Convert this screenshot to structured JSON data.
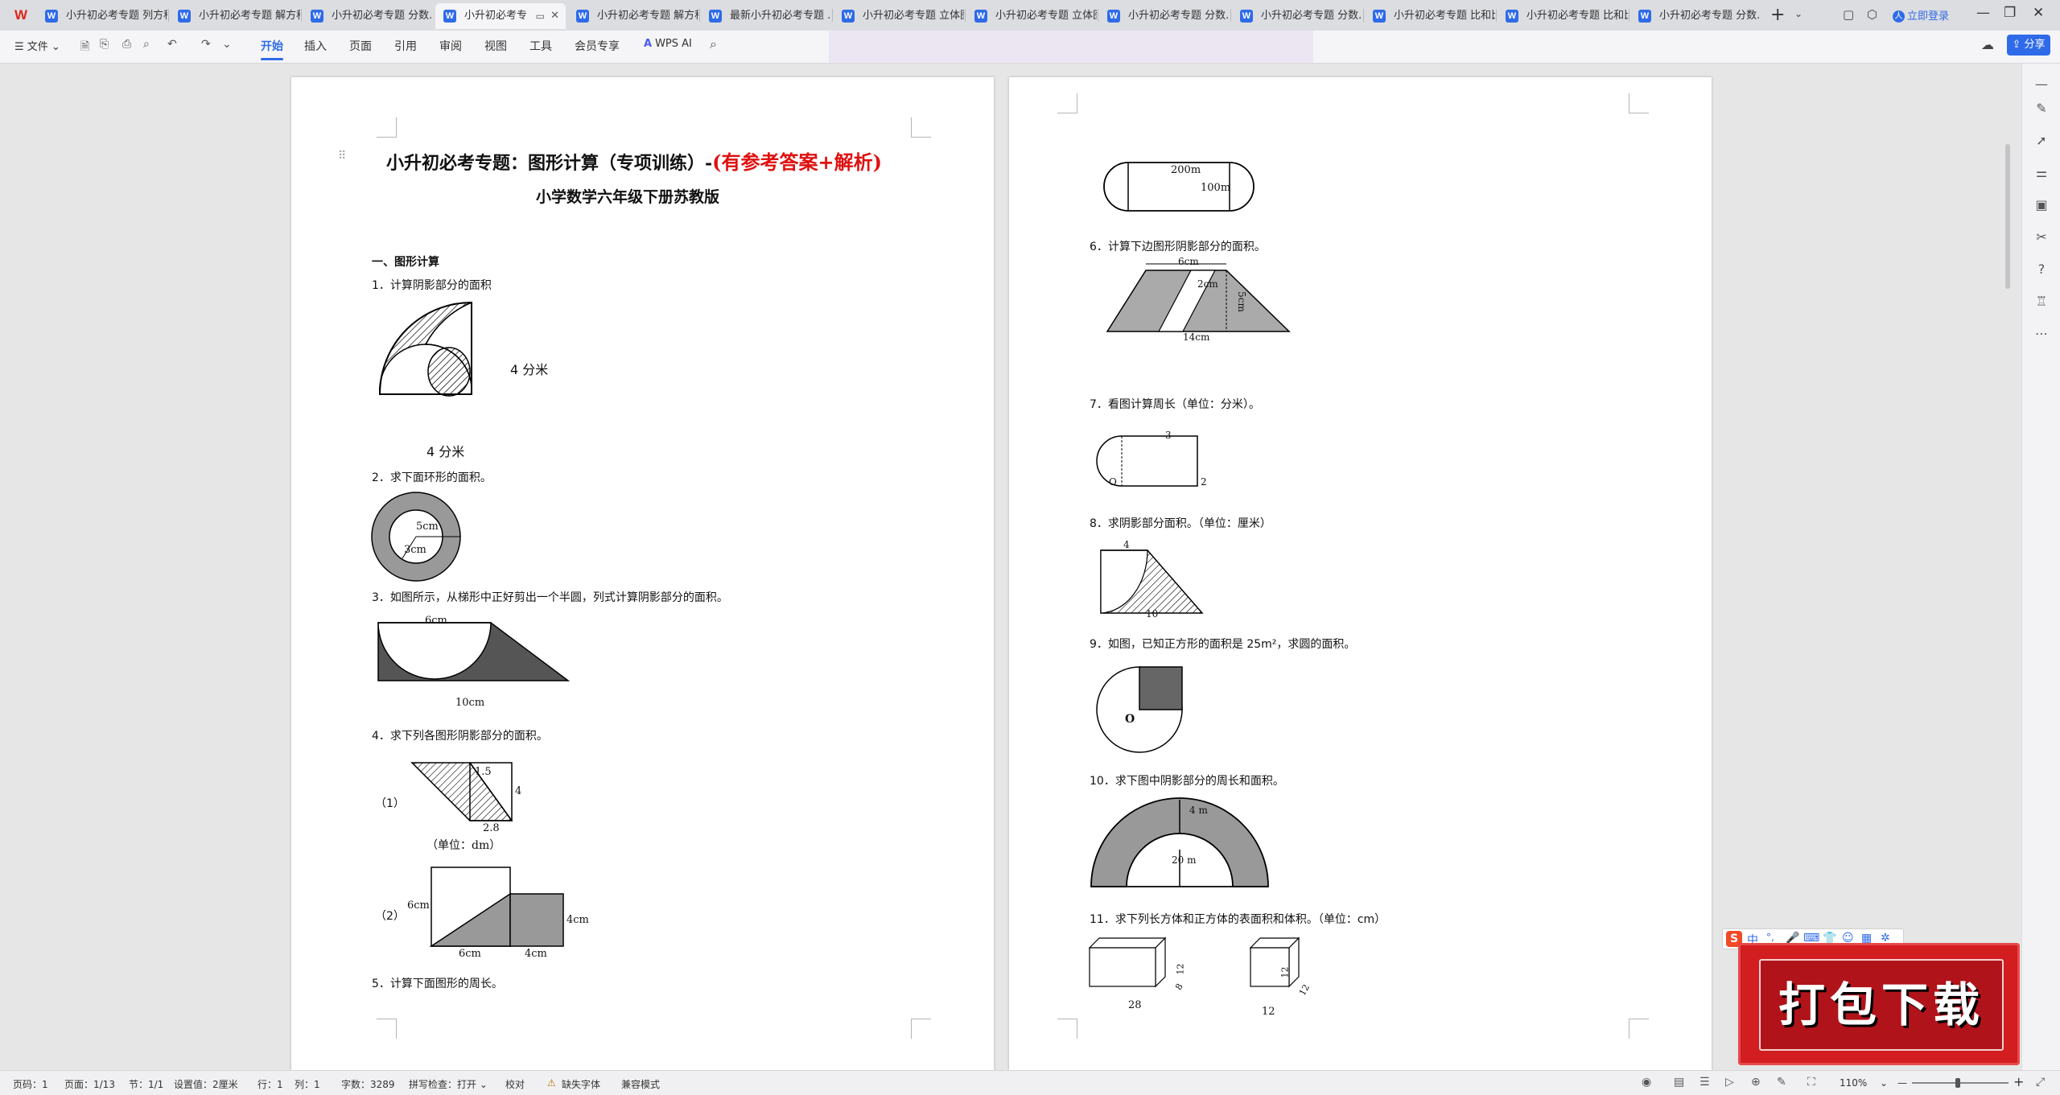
{
  "tabs": [
    {
      "label": "小升初必考专题 列方程"
    },
    {
      "label": "小升初必考专题 解方程"
    },
    {
      "label": "小升初必考专题 分数..."
    },
    {
      "label": "小升初必考专"
    },
    {
      "label": "小升初必考专题 解方程"
    },
    {
      "label": "最新小升初必考专题 ..."
    },
    {
      "label": "小升初必考专题 立体图"
    },
    {
      "label": "小升初必考专题 立体图"
    },
    {
      "label": "小升初必考专题 分数..."
    },
    {
      "label": "小升初必考专题 分数..."
    },
    {
      "label": "小升初必考专题 比和比"
    },
    {
      "label": "小升初必考专题 比和比"
    },
    {
      "label": "小升初必考专题 分数..."
    }
  ],
  "login_label": "立即登录",
  "share_label": "分享",
  "file_menu": "☰ 文件 ⌄",
  "ribbon_tabs": [
    "开始",
    "插入",
    "页面",
    "引用",
    "审阅",
    "视图",
    "工具",
    "会员专享"
  ],
  "wps_ai": "WPS AI",
  "page1": {
    "title_black": "小升初必考专题：图形计算（专项训练）-",
    "title_red": "(有参考答案+解析)",
    "subtitle": "小学数学六年级下册苏教版",
    "section": "一、图形计算",
    "q1": "1．计算阴影部分的面积",
    "q1_side": "4 分米",
    "q1_bottom": "4 分米",
    "q2": "2．求下面环形的面积。",
    "q2_outer": "5cm",
    "q2_inner": "3cm",
    "q3": "3．如图所示，从梯形中正好剪出一个半圆，列式计算阴影部分的面积。",
    "q3_top": "6cm",
    "q3_bottom": "10cm",
    "q4": "4．求下列各图形阴影部分的面积。",
    "q4_1": "（1）",
    "q4_1_a": "1.5",
    "q4_1_b": "4",
    "q4_1_c": "2.8",
    "q4_1_unit": "（单位：dm）",
    "q4_2": "（2）",
    "q4_2_left": "6cm",
    "q4_2_right": "4cm",
    "q4_2_b1": "6cm",
    "q4_2_b2": "4cm",
    "q5": "5．计算下面图形的周长。"
  },
  "page2": {
    "q5_a": "200m",
    "q5_b": "100m",
    "q6": "6．计算下边图形阴影部分的面积。",
    "q6_top": "6cm",
    "q6_mid": "2cm",
    "q6_h": "5cm",
    "q6_bottom": "14cm",
    "q7": "7．看图计算周长（单位：分米）。",
    "q7_top": "3",
    "q7_side": "2",
    "q7_o": "O",
    "q8": "8．求阴影部分面积。（单位：厘米）",
    "q8_top": "4",
    "q8_bottom": "10",
    "q9": "9．如图，已知正方形的面积是 25m²，求圆的面积。",
    "q9_o": "O",
    "q10": "10．求下图中阴影部分的周长和面积。",
    "q10_a": "4 m",
    "q10_b": "20 m",
    "q11": "11．求下列长方体和正方体的表面积和体积。（单位：cm）",
    "q11_a": "28",
    "q11_b": "12",
    "q11_c": "8",
    "q11_d": "12",
    "q11_e": "12",
    "q11_f": "12"
  },
  "statusbar": {
    "page": "页码：1",
    "pages": "页面：1/13",
    "section": "节：1/1",
    "setting": "设置值：2厘米",
    "row": "行：1",
    "col": "列：1",
    "words": "字数：3289",
    "spell": "拼写检查：打开 ⌄",
    "proof": "校对",
    "missing_font": "缺失字体",
    "compat": "兼容模式",
    "zoom": "110%"
  },
  "ime": {
    "label": "中"
  },
  "ad": {
    "label": "打包下载"
  }
}
